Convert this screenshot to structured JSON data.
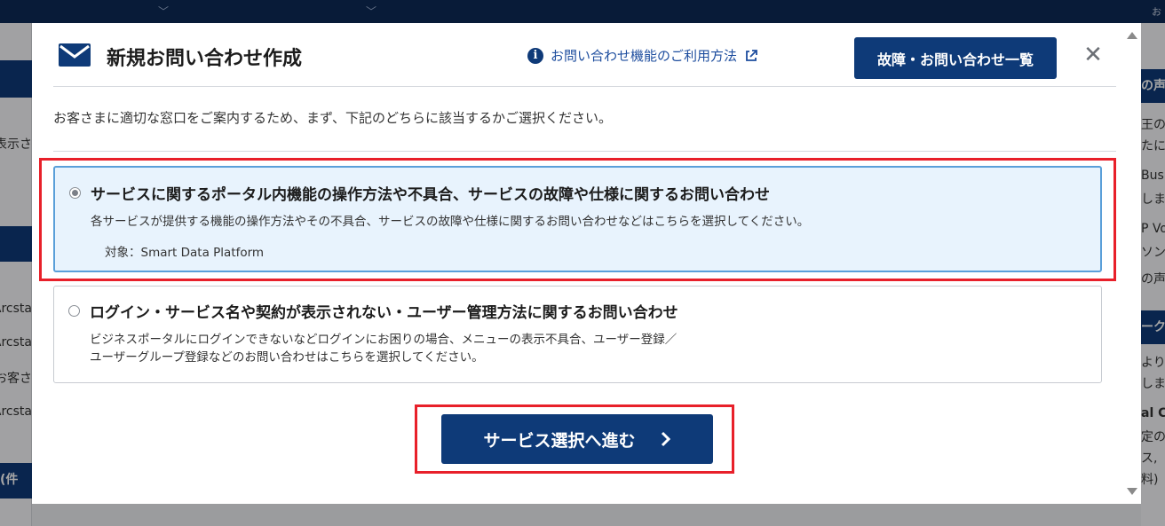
{
  "background": {
    "top_right_text": "お",
    "left_fragments": [
      "表示さ",
      "Arcsta",
      "Arcsta",
      "お客さ",
      "Arcsta",
      "件)"
    ],
    "right_fragments": [
      "の声",
      "王の",
      "たに",
      "Bus",
      "しま",
      "P Vo",
      "ソンロ",
      "の声",
      "ーク",
      "より",
      "しま",
      "al C",
      "定の",
      "ス,",
      "料)"
    ]
  },
  "modal": {
    "title": "新規お問い合わせ作成",
    "help_link": "お問い合わせ機能のご利用方法",
    "list_button": "故障・お問い合わせ一覧",
    "intro": "お客さまに適切な窓口をご案内するため、まず、下記のどちらに該当するかご選択ください。",
    "options": [
      {
        "title": "サービスに関するポータル内機能の操作方法や不具合、サービスの故障や仕様に関するお問い合わせ",
        "desc1": "各サービスが提供する機能の操作方法やその不具合、サービスの故障や仕様に関するお問い合わせなどはこちらを選択してください。",
        "target": "対象：Smart Data Platform",
        "selected": true
      },
      {
        "title": "ログイン・サービス名や契約が表示されない・ユーザー管理方法に関するお問い合わせ",
        "desc1": "ビジネスポータルにログインできないなどログインにお困りの場合、メニューの表示不具合、ユーザー登録／",
        "desc2": "ユーザーグループ登録などのお問い合わせはこちらを選択してください。",
        "selected": false
      }
    ],
    "proceed_button": "サービス選択へ進む"
  },
  "colors": {
    "brand_navy": "#0e3a78",
    "selected_bg": "#e8f3fd",
    "highlight_red": "#e8202a"
  }
}
